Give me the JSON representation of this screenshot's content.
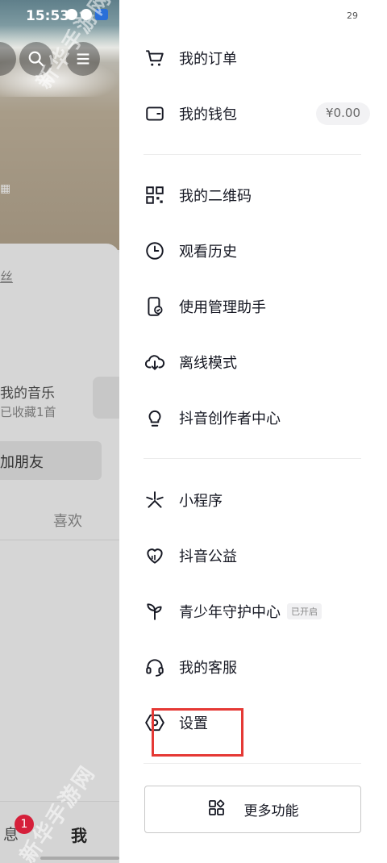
{
  "status_bar": {
    "time": "15:53",
    "drawer_clock": "29"
  },
  "background": {
    "fans_text": "丝",
    "music_title": "我的音乐",
    "music_subtitle": "已收藏1首",
    "add_friend": "加朋友",
    "like_tab": "喜欢",
    "nav_message": "息",
    "nav_badge": "1",
    "nav_me": "我",
    "watermark": "新华手游网"
  },
  "drawer": {
    "items": [
      {
        "label": "我的订单",
        "icon": "cart-icon"
      },
      {
        "label": "我的钱包",
        "icon": "wallet-icon",
        "chip": "¥0.00"
      },
      {
        "label": "我的二维码",
        "icon": "qr-code-icon"
      },
      {
        "label": "观看历史",
        "icon": "clock-icon"
      },
      {
        "label": "使用管理助手",
        "icon": "phone-check-icon"
      },
      {
        "label": "离线模式",
        "icon": "cloud-download-icon"
      },
      {
        "label": "抖音创作者中心",
        "icon": "lightbulb-icon"
      },
      {
        "label": "小程序",
        "icon": "mini-program-icon"
      },
      {
        "label": "抖音公益",
        "icon": "heart-hands-icon"
      },
      {
        "label": "青少年守护中心",
        "icon": "sprout-icon",
        "tag": "已开启"
      },
      {
        "label": "我的客服",
        "icon": "headset-icon"
      },
      {
        "label": "设置",
        "icon": "hexagon-gear-icon"
      }
    ],
    "more_button": "更多功能"
  },
  "colors": {
    "highlight": "#e53935",
    "badge": "#d51f3a",
    "text": "#161823"
  }
}
